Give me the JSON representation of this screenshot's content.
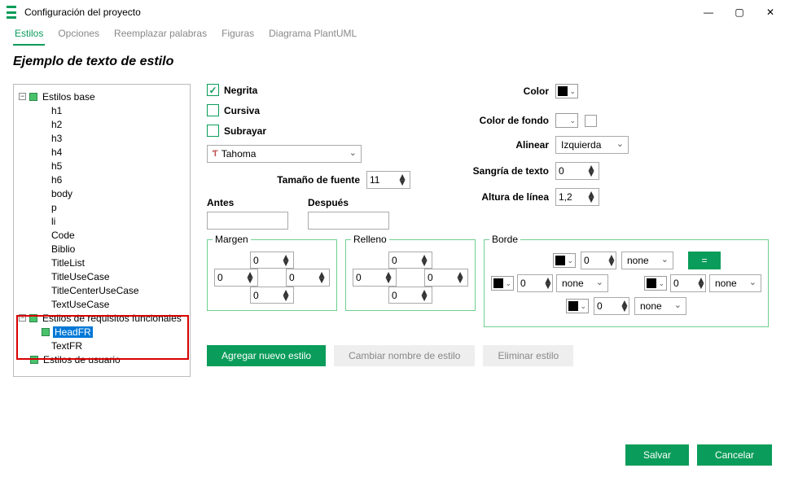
{
  "window": {
    "title": "Configuración del proyecto"
  },
  "tabs": [
    "Estilos",
    "Opciones",
    "Reemplazar palabras",
    "Figuras",
    "Diagrama PlantUML"
  ],
  "example_label": "Ejemplo de texto de estilo",
  "tree": {
    "base": {
      "label": "Estilos base",
      "items": [
        "h1",
        "h2",
        "h3",
        "h4",
        "h5",
        "h6",
        "body",
        "p",
        "li",
        "Code",
        "Biblio",
        "TitleList",
        "TitleUseCase",
        "TitleCenterUseCase",
        "TextUseCase"
      ]
    },
    "func": {
      "label": "Estilos de requisitos funcionales",
      "items": [
        "HeadFR",
        "TextFR"
      ]
    },
    "user": {
      "label": "Estilos de usuario"
    }
  },
  "form": {
    "bold": "Negrita",
    "italic": "Cursiva",
    "underline": "Subrayar",
    "color": "Color",
    "bgcolor": "Color de fondo",
    "align": "Alinear",
    "align_value": "Izquierda",
    "font": "Tahoma",
    "fontsize_label": "Tamaño de fuente",
    "fontsize": "11",
    "indent_label": "Sangría de texto",
    "indent": "0",
    "lineheight_label": "Altura de línea",
    "lineheight": "1,2",
    "before": "Antes",
    "after": "Después",
    "margin": "Margen",
    "padding": "Relleno",
    "border": "Borde",
    "zero": "0",
    "none": "none",
    "eq": "="
  },
  "actions": {
    "add": "Agregar nuevo estilo",
    "rename": "Cambiar nombre de estilo",
    "del": "Eliminar estilo"
  },
  "footer": {
    "save": "Salvar",
    "cancel": "Cancelar"
  }
}
